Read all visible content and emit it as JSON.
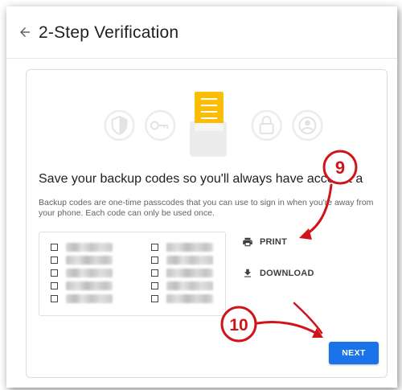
{
  "header": {
    "title": "2-Step Verification"
  },
  "main": {
    "heading": "Save your backup codes so you'll always have account a",
    "description": "Backup codes are one-time passcodes that you can use to sign in when you're away from your phone. Each code can only be used once.",
    "codes_left": [
      "",
      "",
      "",
      "",
      ""
    ],
    "codes_right": [
      "",
      "",
      "",
      "",
      ""
    ],
    "print_label": "PRINT",
    "download_label": "DOWNLOAD",
    "next_label": "NEXT"
  },
  "annotations": {
    "step_9": "9",
    "step_10": "10"
  },
  "colors": {
    "accent": "#1a73e8",
    "note_yellow": "#fbbc04",
    "callout_red": "#d0141a"
  }
}
